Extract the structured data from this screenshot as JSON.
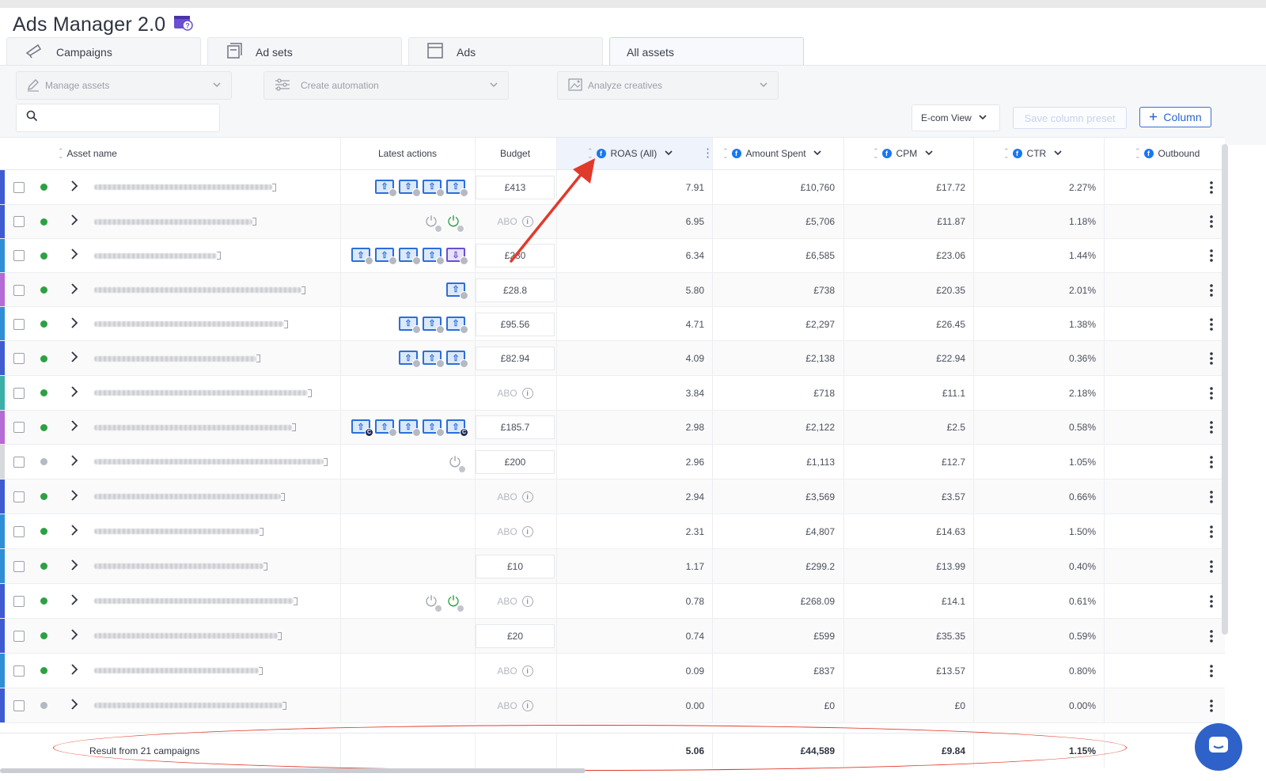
{
  "app": {
    "title": "Ads Manager 2.0",
    "accent_color": "#2e63d0",
    "title_icon": "ads-manager-logo-icon"
  },
  "tabs": [
    {
      "label": "Campaigns",
      "icon": "megaphone-icon",
      "active": false
    },
    {
      "label": "Ad sets",
      "icon": "stacked-cards-icon",
      "active": false
    },
    {
      "label": "Ads",
      "icon": "ad-square-icon",
      "active": false
    },
    {
      "label": "All assets",
      "icon": "",
      "active": true
    }
  ],
  "toolbar": {
    "manage_assets": "Manage assets",
    "create_automation": "Create automation",
    "analyze_creatives": "Analyze creatives",
    "search_placeholder": "",
    "view_select": "E-com View",
    "save_preset": "Save column preset",
    "add_column": "Column"
  },
  "columns": {
    "asset_name": "Asset name",
    "latest_actions": "Latest actions",
    "budget": "Budget",
    "roas": "ROAS (All)",
    "amount_spent": "Amount Spent",
    "cpm": "CPM",
    "ctr": "CTR",
    "outbound": "Outbound"
  },
  "rows": [
    {
      "stripe": "#3f5bd1",
      "status": "active",
      "actions": [
        "upload",
        "upload",
        "upload",
        "upload"
      ],
      "budget": "£413",
      "roas": "7.91",
      "spent": "£10,760",
      "cpm": "£17.72",
      "ctr": "2.27%"
    },
    {
      "stripe": "#3f5bd1",
      "status": "active",
      "actions": [
        "power-off",
        "power-on"
      ],
      "budget": "ABO",
      "roas": "6.95",
      "spent": "£5,706",
      "cpm": "£11.87",
      "ctr": "1.18%"
    },
    {
      "stripe": "#2f8fd6",
      "status": "active",
      "actions": [
        "upload",
        "upload",
        "upload",
        "upload",
        "download"
      ],
      "budget": "£280",
      "roas": "6.34",
      "spent": "£6,585",
      "cpm": "£23.06",
      "ctr": "1.44%"
    },
    {
      "stripe": "#b66ad6",
      "status": "active",
      "actions": [
        "upload"
      ],
      "budget": "£28.8",
      "roas": "5.80",
      "spent": "£738",
      "cpm": "£20.35",
      "ctr": "2.01%"
    },
    {
      "stripe": "#2f8fd6",
      "status": "active",
      "actions": [
        "upload",
        "upload",
        "upload"
      ],
      "budget": "£95.56",
      "roas": "4.71",
      "spent": "£2,297",
      "cpm": "£26.45",
      "ctr": "1.38%"
    },
    {
      "stripe": "#3f5bd1",
      "status": "active",
      "actions": [
        "upload",
        "upload",
        "upload"
      ],
      "budget": "£82.94",
      "roas": "4.09",
      "spent": "£2,138",
      "cpm": "£22.94",
      "ctr": "0.36%"
    },
    {
      "stripe": "#3bb0a6",
      "status": "active",
      "actions": [],
      "budget": "ABO",
      "roas": "3.84",
      "spent": "£718",
      "cpm": "£11.1",
      "ctr": "2.18%"
    },
    {
      "stripe": "#b66ad6",
      "status": "active",
      "actions": [
        "upload-c",
        "upload",
        "upload",
        "upload",
        "upload-c"
      ],
      "budget": "£185.7",
      "roas": "2.98",
      "spent": "£2,122",
      "cpm": "£2.5",
      "ctr": "0.58%"
    },
    {
      "stripe": "#d7d9dd",
      "status": "inactive",
      "actions": [
        "power-off"
      ],
      "budget": "£200",
      "roas": "2.96",
      "spent": "£1,113",
      "cpm": "£12.7",
      "ctr": "1.05%"
    },
    {
      "stripe": "#3f5bd1",
      "status": "active",
      "actions": [],
      "budget": "ABO",
      "roas": "2.94",
      "spent": "£3,569",
      "cpm": "£3.57",
      "ctr": "0.66%"
    },
    {
      "stripe": "#2f8fd6",
      "status": "active",
      "actions": [],
      "budget": "ABO",
      "roas": "2.31",
      "spent": "£4,807",
      "cpm": "£14.63",
      "ctr": "1.50%"
    },
    {
      "stripe": "#2f8fd6",
      "status": "active",
      "actions": [],
      "budget": "£10",
      "roas": "1.17",
      "spent": "£299.2",
      "cpm": "£13.99",
      "ctr": "0.40%"
    },
    {
      "stripe": "#3f5bd1",
      "status": "active",
      "actions": [
        "power-off",
        "power-on"
      ],
      "budget": "ABO",
      "roas": "0.78",
      "spent": "£268.09",
      "cpm": "£14.1",
      "ctr": "0.61%"
    },
    {
      "stripe": "#3f5bd1",
      "status": "active",
      "actions": [],
      "budget": "£20",
      "roas": "0.74",
      "spent": "£599",
      "cpm": "£35.35",
      "ctr": "0.59%"
    },
    {
      "stripe": "#2f8fd6",
      "status": "active",
      "actions": [],
      "budget": "ABO",
      "roas": "0.09",
      "spent": "£837",
      "cpm": "£13.57",
      "ctr": "0.80%"
    },
    {
      "stripe": "#3f5bd1",
      "status": "inactive",
      "actions": [],
      "budget": "ABO",
      "roas": "0.00",
      "spent": "£0",
      "cpm": "£0",
      "ctr": "0.00%"
    }
  ],
  "footer": {
    "label": "Result from 21 campaigns",
    "roas": "5.06",
    "spent": "£44,589",
    "cpm": "£9.84",
    "ctr": "1.15%"
  },
  "colors": {
    "active_dot": "#2ea043",
    "inactive_dot": "#b5b9c1",
    "annotation": "#e03a2b"
  }
}
